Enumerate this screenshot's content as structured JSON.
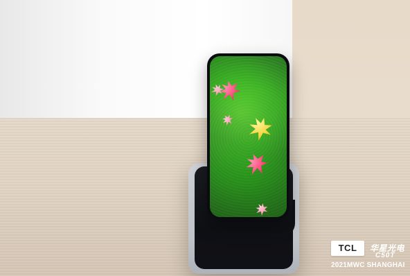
{
  "watermark": {
    "brand": "TCL",
    "chinese_text": "华星光电",
    "model": "C50T",
    "event": "2021MWC SHANGHAI"
  },
  "scene": {
    "subject": "phone-on-stand",
    "screen_content": "moss-with-leaves"
  },
  "colors": {
    "moss_green": "#3f9a2e",
    "leaf_red": "#ff4f7f",
    "leaf_yellow": "#f6d43c",
    "stand_dark": "#101116",
    "stand_base": "#bfc3c8"
  }
}
